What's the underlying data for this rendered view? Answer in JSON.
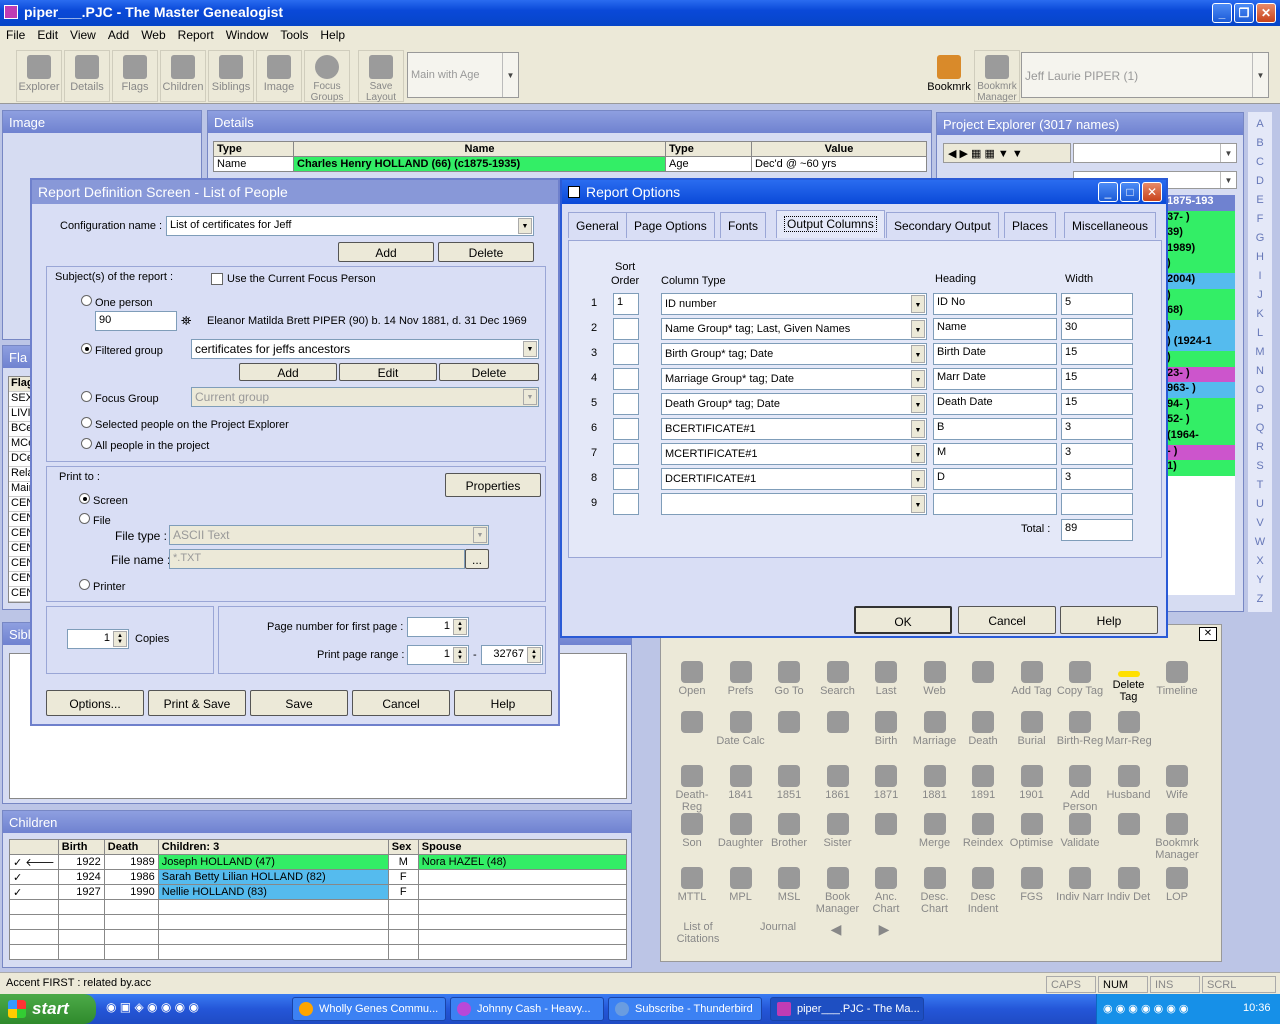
{
  "window": {
    "title": "piper___.PJC - The Master Genealogist",
    "min": "_",
    "max": "❐",
    "close": "✕"
  },
  "menu": [
    "File",
    "Edit",
    "View",
    "Add",
    "Web",
    "Report",
    "Window",
    "Tools",
    "Help"
  ],
  "toolbar": {
    "buttons": [
      "Explorer",
      "Details",
      "Flags",
      "Children",
      "Siblings",
      "Image",
      "Focus Groups",
      "Save Layout"
    ],
    "layout_combo": "Main with Age",
    "bookmark": "Bookmrk",
    "bookmark_manager": "Bookmrk Manager",
    "person_combo": "Jeff Laurie PIPER (1)"
  },
  "image_panel": {
    "title": "Image"
  },
  "details_panel": {
    "title": "Details",
    "cols": [
      "Type",
      "Name",
      "Type",
      "Value"
    ],
    "row": {
      "type": "Name",
      "name": "Charles Henry HOLLAND (66)  (c1875-1935)",
      "type2": "Age",
      "value": "Dec'd @ ~60 yrs"
    }
  },
  "project_explorer": {
    "title": "Project Explorer (3017 names)",
    "snips": [
      "1875-193",
      "37-  )",
      "39)",
      "1989)",
      ")",
      "2004)",
      ")",
      "68)",
      ")",
      ") (1924-1",
      ")",
      "23-  )",
      "963-  )",
      "94-  )",
      "52-  )",
      "(1964-",
      "-  )",
      "1)"
    ],
    "alphabet": [
      "A",
      "B",
      "C",
      "D",
      "E",
      "F",
      "G",
      "H",
      "I",
      "J",
      "K",
      "L",
      "M",
      "N",
      "O",
      "P",
      "Q",
      "R",
      "S",
      "T",
      "U",
      "V",
      "W",
      "X",
      "Y",
      "Z"
    ]
  },
  "flags_panel": {
    "title": "Fla",
    "items": [
      "Flag",
      "SEX",
      "LIVI",
      "BCe",
      "MCe",
      "DCe",
      "Rela",
      "Mair",
      "CEN",
      "CEN",
      "CEN",
      "CEN",
      "CEN",
      "CEN",
      "CEN"
    ]
  },
  "siblings_panel": {
    "title": "Sibl"
  },
  "children_panel": {
    "title": "Children",
    "cols": [
      "Birth",
      "Death",
      "Children: 3",
      "Sex",
      "Spouse"
    ],
    "rows": [
      {
        "mark": "✓",
        "arrow": "🡐",
        "birth": "1922",
        "death": "1989",
        "child": "Joseph HOLLAND (47)",
        "sex": "M",
        "spouse": "Nora HAZEL (48)",
        "color": "#33ee66"
      },
      {
        "mark": "✓",
        "arrow": "",
        "birth": "1924",
        "death": "1986",
        "child": "Sarah Betty Lilian HOLLAND (82)",
        "sex": "F",
        "spouse": "",
        "color": "#55bbee"
      },
      {
        "mark": "✓",
        "arrow": "",
        "birth": "1927",
        "death": "1990",
        "child": "Nellie HOLLAND (83)",
        "sex": "F",
        "spouse": "",
        "color": "#55bbee"
      }
    ]
  },
  "report_def": {
    "title": "Report Definition Screen - List of People",
    "config_label": "Configuration name :",
    "config_value": "List of certificates for Jeff",
    "add": "Add",
    "delete": "Delete",
    "subjects_label": "Subject(s) of the report :",
    "use_current": "Use the Current Focus Person",
    "one_person": "One person",
    "person_id": "90",
    "person_name": "Eleanor Matilda Brett PIPER (90) b. 14 Nov 1881, d. 31 Dec 1969",
    "filtered_group": "Filtered group",
    "filter_value": "certificates for jeffs ancestors",
    "fg_add": "Add",
    "fg_edit": "Edit",
    "fg_delete": "Delete",
    "focus_group": "Focus Group",
    "focus_value": "Current group",
    "selected_people": "Selected people on the Project Explorer",
    "all_people": "All people in the project",
    "print_to": "Print to :",
    "properties": "Properties",
    "screen": "Screen",
    "file": "File",
    "file_type_label": "File type :",
    "file_type": "ASCII Text",
    "file_name_label": "File name :",
    "file_name": "*.TXT",
    "browse": "...",
    "printer": "Printer",
    "copies_value": "1",
    "copies": "Copies",
    "first_page_label": "Page number for first page :",
    "first_page": "1",
    "range_label": "Print page range :",
    "range_from": "1",
    "range_sep": "-",
    "range_to": "32767",
    "buttons": [
      "Options...",
      "Print & Save",
      "Save",
      "Cancel",
      "Help"
    ]
  },
  "report_options": {
    "title": "Report Options",
    "tabs": [
      "General",
      "Page Options",
      "Fonts",
      "Output Columns",
      "Secondary Output",
      "Places",
      "Miscellaneous"
    ],
    "active_tab": "Output Columns",
    "headers": {
      "sort1": "Sort",
      "sort2": "Order",
      "col_type": "Column Type",
      "heading": "Heading",
      "width": "Width"
    },
    "rows": [
      {
        "n": "1",
        "sort": "1",
        "type": "ID number",
        "heading": "ID No",
        "width": "5"
      },
      {
        "n": "2",
        "sort": "",
        "type": "Name Group* tag; Last, Given Names",
        "heading": "Name",
        "width": "30"
      },
      {
        "n": "3",
        "sort": "",
        "type": "Birth Group* tag; Date",
        "heading": "Birth Date",
        "width": "15"
      },
      {
        "n": "4",
        "sort": "",
        "type": "Marriage Group* tag; Date",
        "heading": "Marr Date",
        "width": "15"
      },
      {
        "n": "5",
        "sort": "",
        "type": "Death Group* tag; Date",
        "heading": "Death Date",
        "width": "15"
      },
      {
        "n": "6",
        "sort": "",
        "type": "BCERTIFICATE#1",
        "heading": "B",
        "width": "3"
      },
      {
        "n": "7",
        "sort": "",
        "type": "MCERTIFICATE#1",
        "heading": "M",
        "width": "3"
      },
      {
        "n": "8",
        "sort": "",
        "type": "DCERTIFICATE#1",
        "heading": "D",
        "width": "3"
      },
      {
        "n": "9",
        "sort": "",
        "type": "",
        "heading": "",
        "width": ""
      }
    ],
    "total_label": "Total :",
    "total": "89",
    "ok": "OK",
    "cancel": "Cancel",
    "help": "Help"
  },
  "tool_palette": {
    "close": "✕",
    "items": [
      [
        "Open",
        "Prefs",
        "Go To",
        "Search",
        "Last",
        "Web",
        "",
        "Add Tag",
        "Copy Tag",
        "Delete Tag",
        "Timeline"
      ],
      [
        "",
        "Date Calc",
        "",
        "",
        "Birth",
        "Marriage",
        "Death",
        "Burial",
        "Birth-Reg",
        "Marr-Reg"
      ],
      [
        "Death-Reg",
        "1841",
        "1851",
        "1861",
        "1871",
        "1881",
        "1891",
        "1901",
        "Add Person",
        "Husband",
        "Wife"
      ],
      [
        "Son",
        "Daughter",
        "Brother",
        "Sister",
        "",
        "Merge",
        "Reindex",
        "Optimise",
        "Validate",
        "",
        "Bookmrk Manager"
      ],
      [
        "MTTL",
        "MPL",
        "MSL",
        "Book Manager",
        "Anc. Chart",
        "Desc. Chart",
        "Desc Indent",
        "FGS",
        "Indiv Narr",
        "Indiv Det",
        "LOP"
      ],
      [
        "List of Citations",
        "Journal",
        "◀",
        "▶"
      ]
    ]
  },
  "status": {
    "text": "Accent FIRST : related by.acc",
    "caps": "CAPS",
    "num": "NUM",
    "ins": "INS",
    "scrl": "SCRL"
  },
  "taskbar": {
    "start": "start",
    "tasks": [
      "Wholly Genes Commu...",
      "Johnny Cash - Heavy...",
      "Subscribe - Thunderbird",
      "piper___.PJC - The Ma..."
    ],
    "clock": "10:36"
  }
}
